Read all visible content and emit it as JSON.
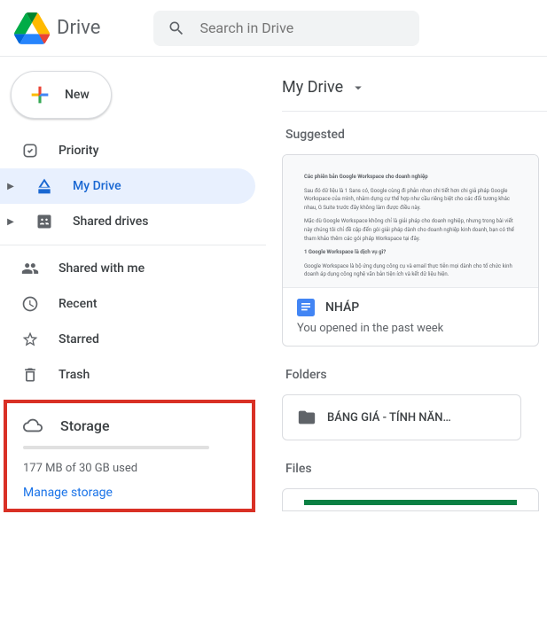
{
  "header": {
    "app_name": "Drive",
    "search_placeholder": "Search in Drive"
  },
  "sidebar": {
    "new_button": "New",
    "items": [
      {
        "label": "Priority",
        "icon": "priority"
      },
      {
        "label": "My Drive",
        "icon": "my-drive",
        "active": true,
        "expandable": true
      },
      {
        "label": "Shared drives",
        "icon": "shared-drives",
        "expandable": true
      },
      {
        "label": "Shared with me",
        "icon": "shared-with-me"
      },
      {
        "label": "Recent",
        "icon": "recent"
      },
      {
        "label": "Starred",
        "icon": "starred"
      },
      {
        "label": "Trash",
        "icon": "trash"
      }
    ],
    "storage": {
      "label": "Storage",
      "usage_text": "177 MB of 30 GB used",
      "manage_link": "Manage storage"
    }
  },
  "content": {
    "breadcrumb": "My Drive",
    "suggested_label": "Suggested",
    "suggested_item": {
      "name": "NHÁP",
      "subtext": "You opened in the past week"
    },
    "folders_label": "Folders",
    "folder_item": {
      "name": "BÁNG GIÁ - TÍNH NĂN…"
    },
    "files_label": "Files"
  }
}
